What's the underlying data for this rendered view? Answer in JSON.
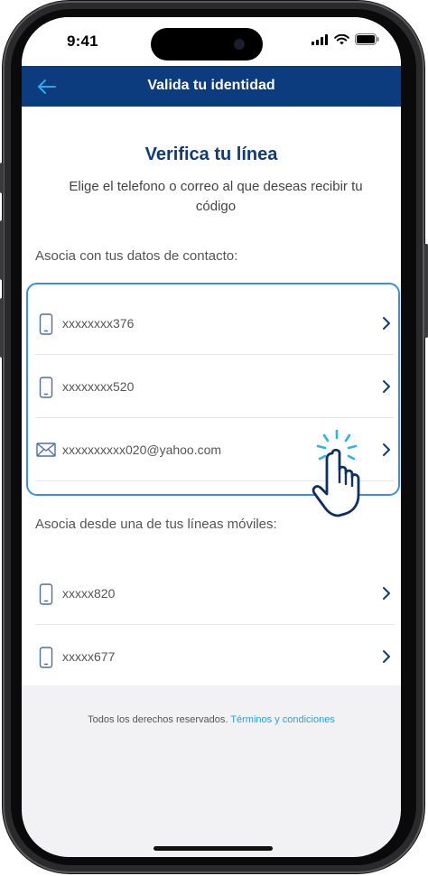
{
  "status_bar": {
    "time": "9:41"
  },
  "header": {
    "title": "Valida tu identidad",
    "back_icon": "arrow-left-icon"
  },
  "main": {
    "title": "Verifica tu línea",
    "subtitle": "Elige el telefono o correo al que deseas recibir tu código"
  },
  "contact_section": {
    "label": "Asocia con tus datos de contacto:",
    "items": [
      {
        "text": "xxxxxxxx376",
        "icon": "phone-icon"
      },
      {
        "text": "xxxxxxxx520",
        "icon": "phone-icon"
      },
      {
        "text": "xxxxxxxxxx020@yahoo.com",
        "icon": "mail-icon"
      }
    ]
  },
  "mobile_section": {
    "label": "Asocia desde una de tus líneas móviles:",
    "items": [
      {
        "text": "xxxxx820",
        "icon": "phone-icon"
      },
      {
        "text": "xxxxx677",
        "icon": "phone-icon"
      }
    ]
  },
  "footer": {
    "text": "Todos los derechos reservados.",
    "link": "Términos y condiciones"
  },
  "colors": {
    "header_bg": "#0c3c7e",
    "title": "#0c3c7e",
    "highlight_border": "#3a8fe0",
    "link": "#2aa0e6",
    "hand_accent": "#29b6e8"
  }
}
